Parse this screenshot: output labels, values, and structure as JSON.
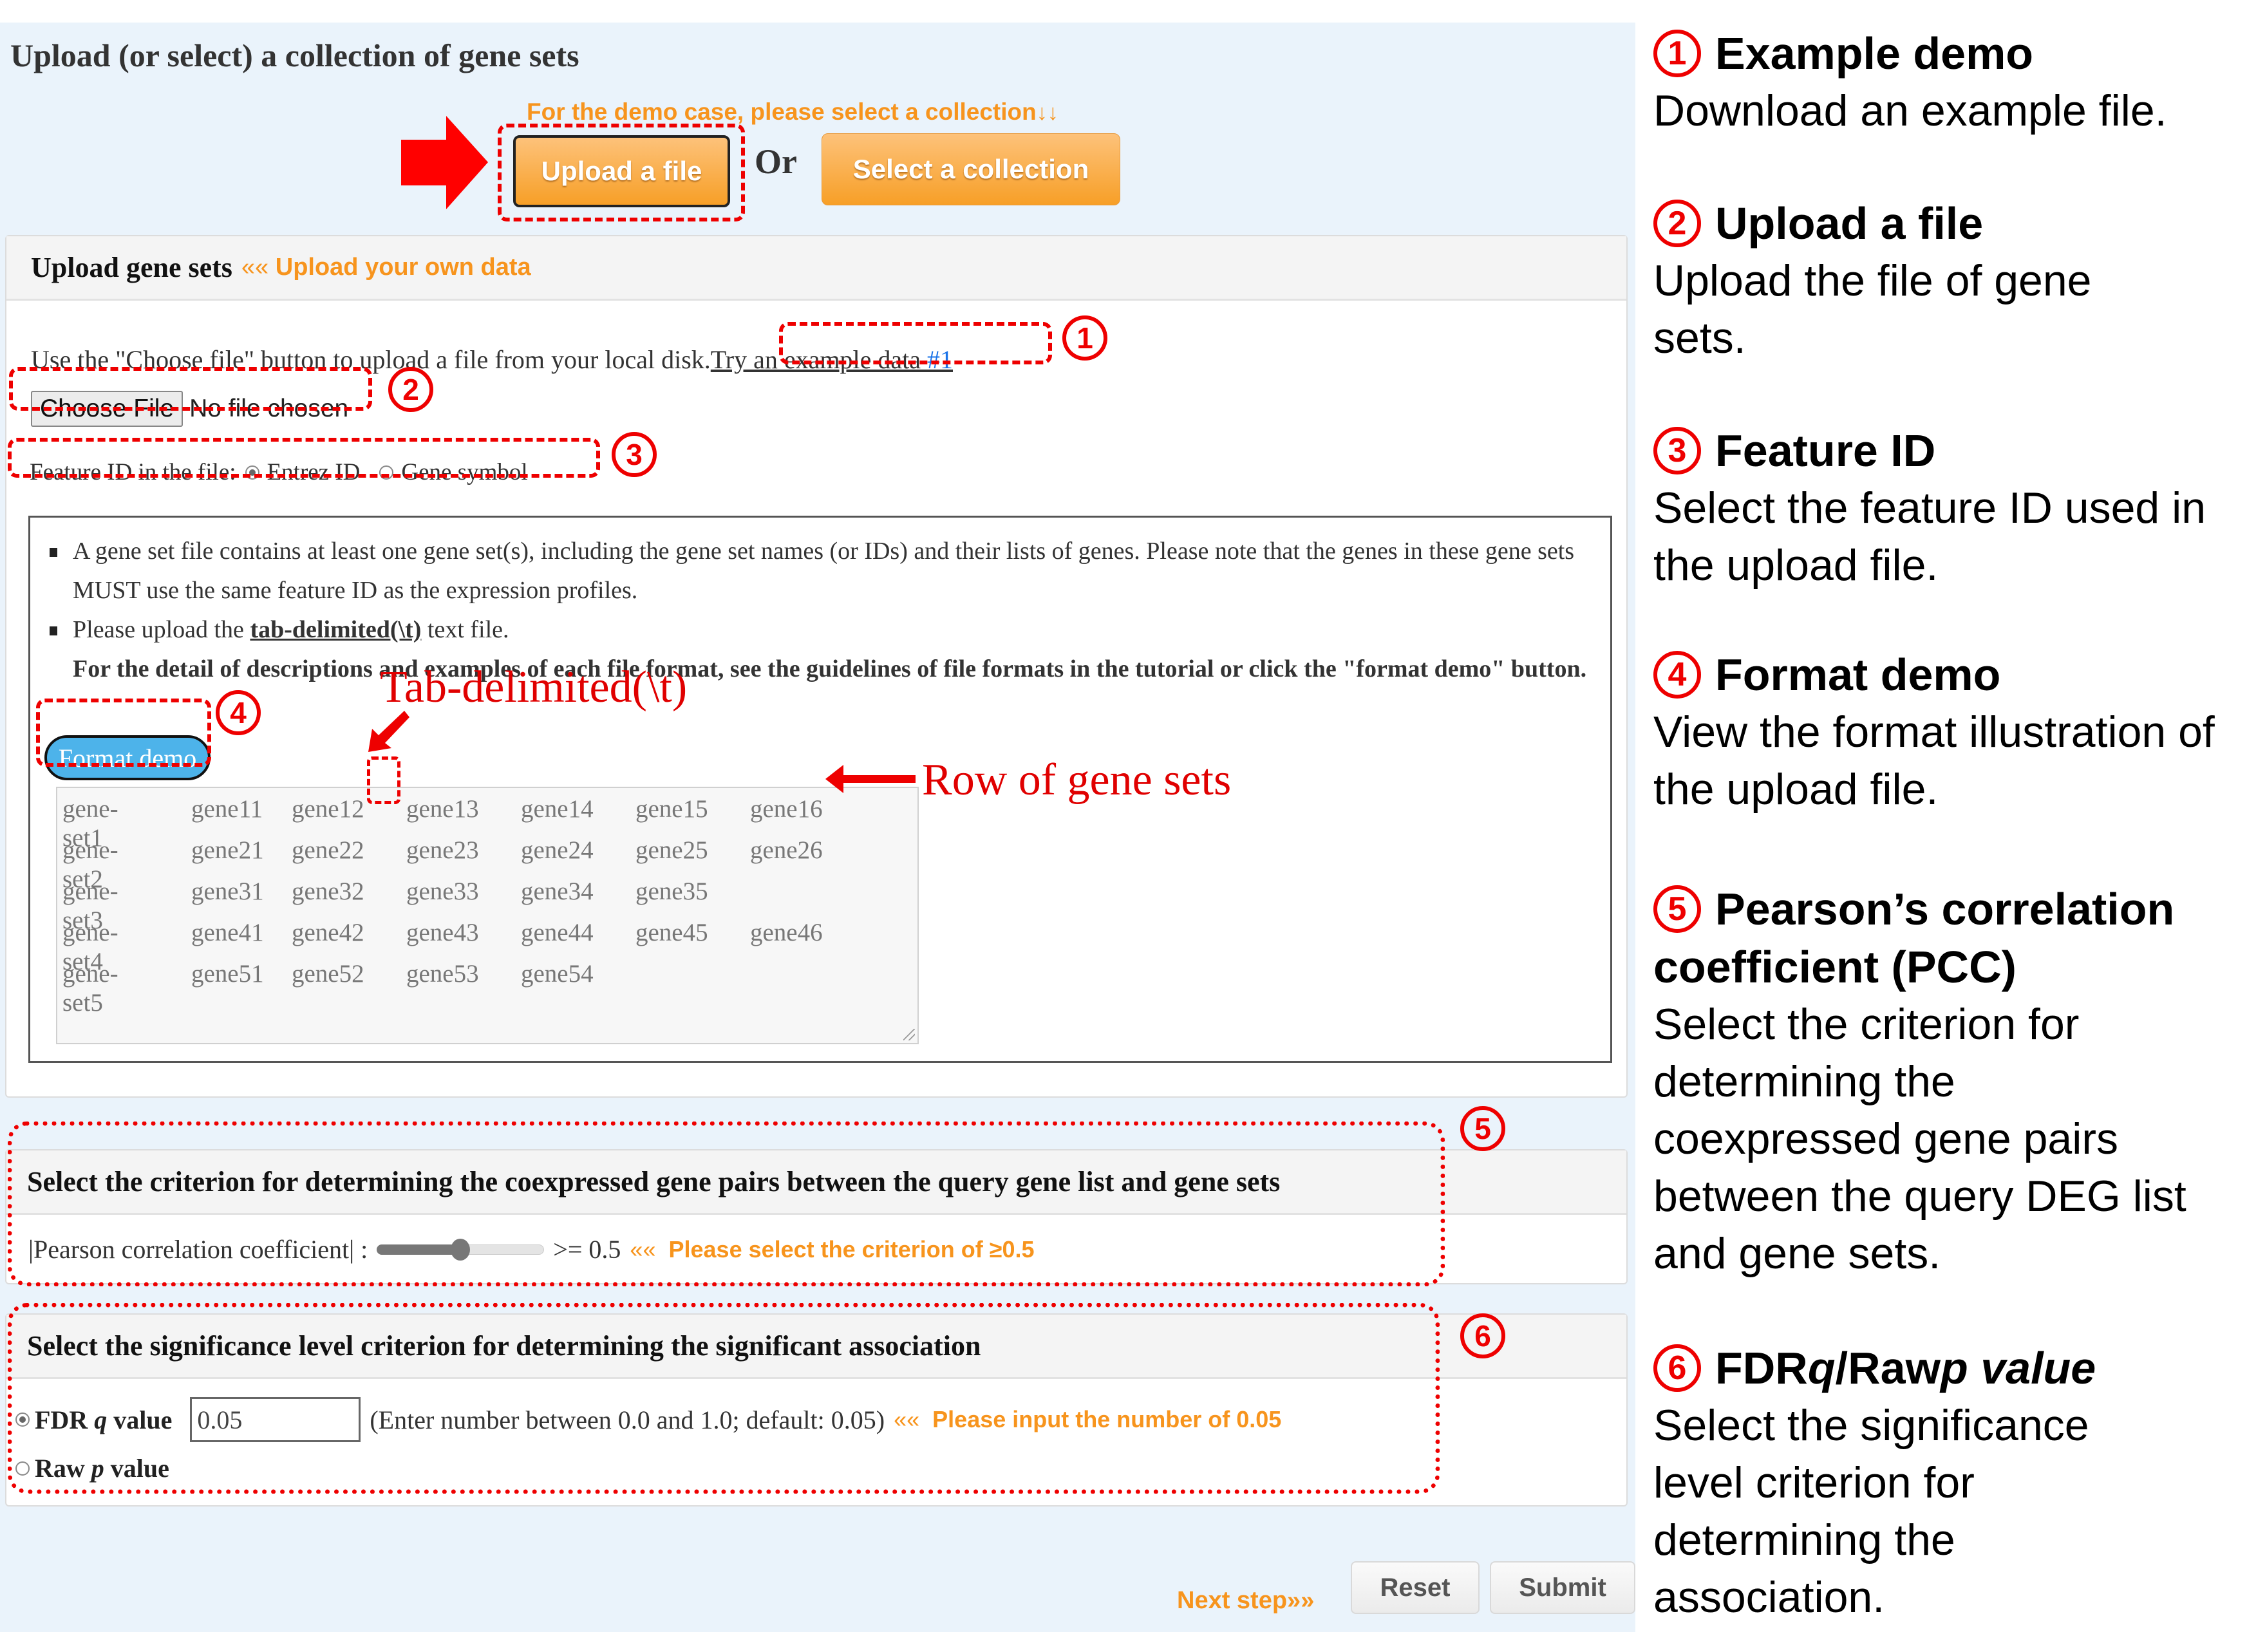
{
  "page": {
    "title": "Upload (or select) a collection of gene sets",
    "demo_hint": "For the demo case, please select a collection",
    "demo_hint_arrows": "↓↓",
    "upload_button": "Upload a file",
    "or_label": "Or",
    "select_button": "Select a collection"
  },
  "upload_panel": {
    "title": "Upload gene sets",
    "subtitle_marker": "««",
    "subtitle": "Upload your own data",
    "instruction": "Use the \"Choose file\" button to upload a file from your local disk.",
    "example_link": "Try an example data",
    "example_link_num": "#1",
    "choose_file_button": "Choose File",
    "file_status": "No file chosen",
    "feature_label": "Feature ID in the file:",
    "feature_options": [
      {
        "label": "Entrez ID",
        "checked": true
      },
      {
        "label": "Gene symbol",
        "checked": false
      }
    ],
    "notes": {
      "item1": "A gene set file contains at least one gene set(s), including the gene set names (or IDs) and their lists of genes. Please note that the genes in these gene sets MUST use the same feature ID as the expression profiles.",
      "item2_prefix": "Please upload the",
      "item2_link": "tab-delimited(\\t)",
      "item2_suffix": "text file.",
      "item2_bold": "For the detail of descriptions and examples of each file format, see the guidelines of file formats in the tutorial or click the \"format demo\" button."
    },
    "format_demo_button": "Format demo",
    "sample_rows": [
      [
        "gene-set1",
        "gene11",
        "gene12",
        "gene13",
        "gene14",
        "gene15",
        "gene16"
      ],
      [
        "gene-set2",
        "gene21",
        "gene22",
        "gene23",
        "gene24",
        "gene25",
        "gene26"
      ],
      [
        "gene-set3",
        "gene31",
        "gene32",
        "gene33",
        "gene34",
        "gene35"
      ],
      [
        "gene-set4",
        "gene41",
        "gene42",
        "gene43",
        "gene44",
        "gene45",
        "gene46"
      ],
      [
        "gene-set5",
        "gene51",
        "gene52",
        "gene53",
        "gene54"
      ]
    ]
  },
  "pcc_panel": {
    "title": "Select the criterion for determining the coexpressed gene pairs between the query gene list and gene sets",
    "label": "|Pearson correlation coefficient| :",
    "slider_value": 0.5,
    "slider_range": [
      0,
      1
    ],
    "value_text": ">= 0.5",
    "hint_marker": "««",
    "hint": "Please select the criterion of ≥0.5"
  },
  "sig_panel": {
    "title": "Select the significance level criterion for determining the significant association",
    "fdr_label_a": "FDR ",
    "fdr_label_q": "q",
    "fdr_label_b": " value",
    "fdr_checked": true,
    "fdr_value": "0.05",
    "fdr_help": "(Enter number between 0.0 and 1.0; default: 0.05)",
    "hint_marker": "««",
    "hint": "Please input the number of 0.05",
    "raw_label_a": "Raw ",
    "raw_label_p": "p",
    "raw_label_b": " value",
    "raw_checked": false
  },
  "footer": {
    "next_step": "Next step»»",
    "reset_button": "Reset",
    "submit_button": "Submit"
  },
  "annotations": {
    "tab_delimited": "Tab-delimited(\\t)",
    "row_of_gene_sets": "Row of gene sets",
    "markers": [
      "1",
      "2",
      "3",
      "4",
      "5",
      "6"
    ]
  },
  "side_notes": [
    {
      "num": "1",
      "title": "Example demo",
      "desc": "Download an example file."
    },
    {
      "num": "2",
      "title": "Upload a file",
      "desc": "Upload the file of gene sets."
    },
    {
      "num": "3",
      "title": "Feature ID",
      "desc": "Select the feature ID used in the upload file."
    },
    {
      "num": "4",
      "title": "Format demo",
      "desc": "View the format illustration of the upload file."
    },
    {
      "num": "5",
      "title": "Pearson’s correlation",
      "title2": "coefficient (PCC)",
      "desc": "Select the criterion for determining the coexpressed gene pairs between the query DEG list and gene sets."
    },
    {
      "num": "6",
      "title_a": "FDR ",
      "title_q": "q",
      "title_b": "/Raw ",
      "title_p": "p value",
      "desc": "Select the significance level criterion for determining the association."
    }
  ],
  "colors": {
    "accent_orange": "#f7941d",
    "annotation_red": "#ee0000",
    "format_button_blue": "#4db3ea",
    "page_background": "#eaf3fb"
  }
}
